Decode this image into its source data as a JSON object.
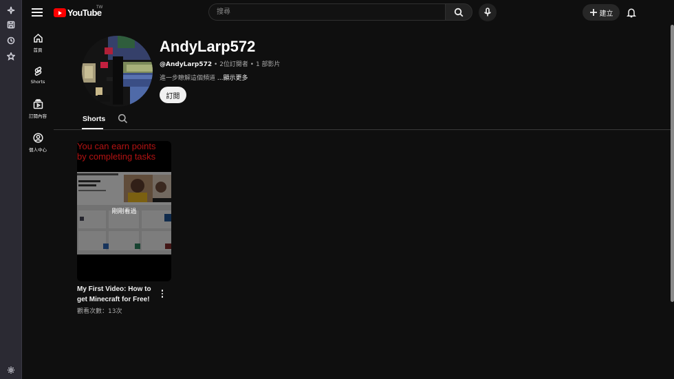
{
  "browser_strip": {
    "icons": [
      "sparkle-icon",
      "save-icon",
      "history-icon",
      "star-icon",
      "settings-icon"
    ]
  },
  "topbar": {
    "logo_text": "YouTube",
    "logo_country": "TW",
    "search": {
      "placeholder": "搜尋"
    },
    "create_label": "建立"
  },
  "guide": {
    "items": [
      {
        "label": "首頁",
        "icon": "home-icon"
      },
      {
        "label": "Shorts",
        "icon": "shorts-icon"
      },
      {
        "label": "訂閱內容",
        "icon": "subscriptions-icon"
      },
      {
        "label": "個人中心",
        "icon": "profile-icon"
      }
    ]
  },
  "channel": {
    "name": "AndyLarp572",
    "handle": "@AndyLarp572",
    "subscribers": "2位訂閱者",
    "videos": "1 部影片",
    "separator": " • ",
    "description": "進一步瞭解這個頻道 ",
    "more": "...顯示更多",
    "subscribe_label": "訂閱"
  },
  "tabs": {
    "active": "Shorts"
  },
  "shorts": [
    {
      "overlay_line1": "You can earn points",
      "overlay_line2": "by completing tasks",
      "watched_label": "剛剛看過",
      "title": "My First Video: How to get Minecraft for Free!",
      "views": "觀看次數：13次"
    }
  ],
  "colors": {
    "background": "#0f0f0f",
    "brand_red": "#ff0000",
    "thumb_red_text": "#b31212",
    "text_primary": "#f1f1f1",
    "text_secondary": "#aaaaaa"
  }
}
